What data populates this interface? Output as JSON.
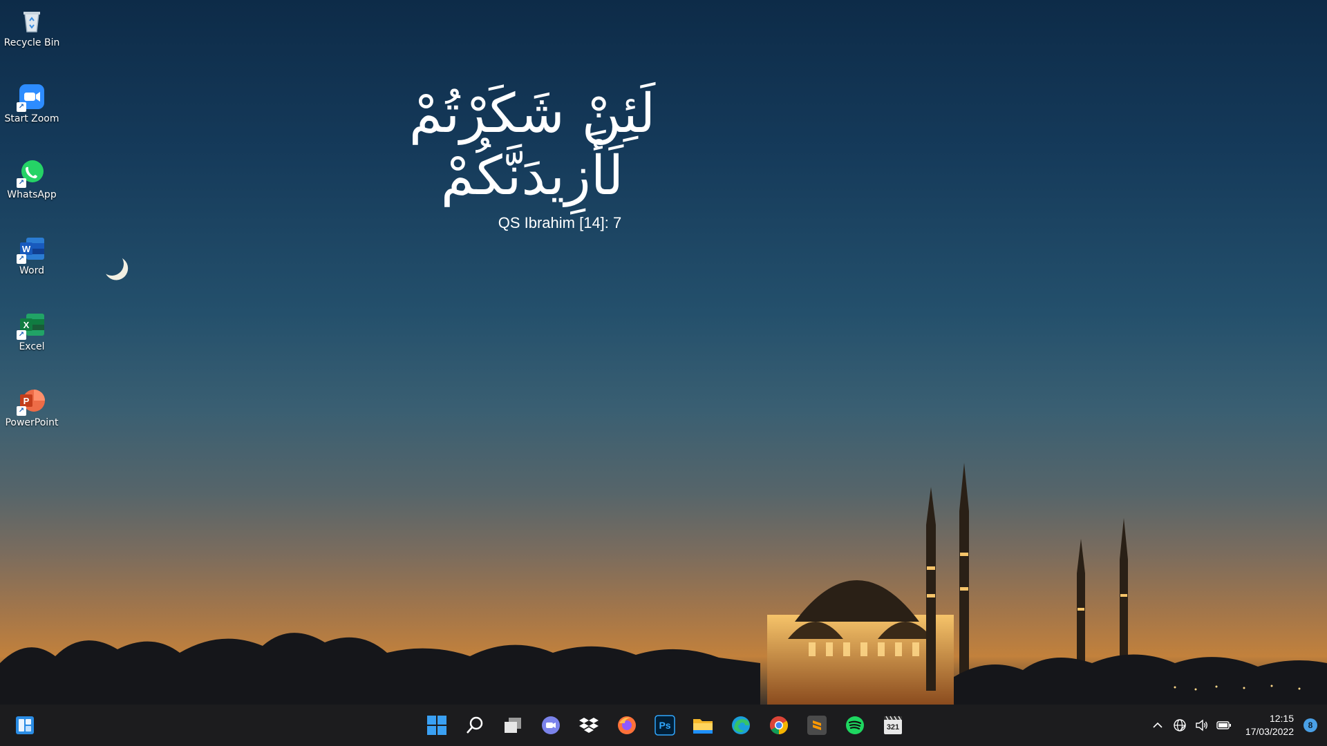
{
  "wallpaper": {
    "arabic_text": "لَئِنْ شَكَرْتُمْ لَأَزِيدَنَّكُمْ",
    "verse_reference": "QS Ibrahim [14]: 7"
  },
  "desktop_icons": [
    {
      "label": "Recycle Bin",
      "icon": "recycle-bin-icon"
    },
    {
      "label": "Start Zoom",
      "icon": "zoom-icon"
    },
    {
      "label": "WhatsApp",
      "icon": "whatsapp-icon"
    },
    {
      "label": "Word",
      "icon": "word-icon"
    },
    {
      "label": "Excel",
      "icon": "excel-icon"
    },
    {
      "label": "PowerPoint",
      "icon": "powerpoint-icon"
    }
  ],
  "taskbar": {
    "pinned": [
      "start-icon",
      "search-icon",
      "task-view-icon",
      "teams-chat-icon",
      "dropbox-icon",
      "firefox-icon",
      "photoshop-icon",
      "file-explorer-icon",
      "edge-icon",
      "chrome-icon",
      "sublime-text-icon",
      "spotify-icon",
      "media-player-icon"
    ],
    "photoshop_label": "Ps",
    "media_label": "321",
    "time": "12:15",
    "date": "17/03/2022",
    "notification_count": "8"
  },
  "colors": {
    "taskbar_bg": "#1c1c1e",
    "accent": "#4aa0e6"
  }
}
